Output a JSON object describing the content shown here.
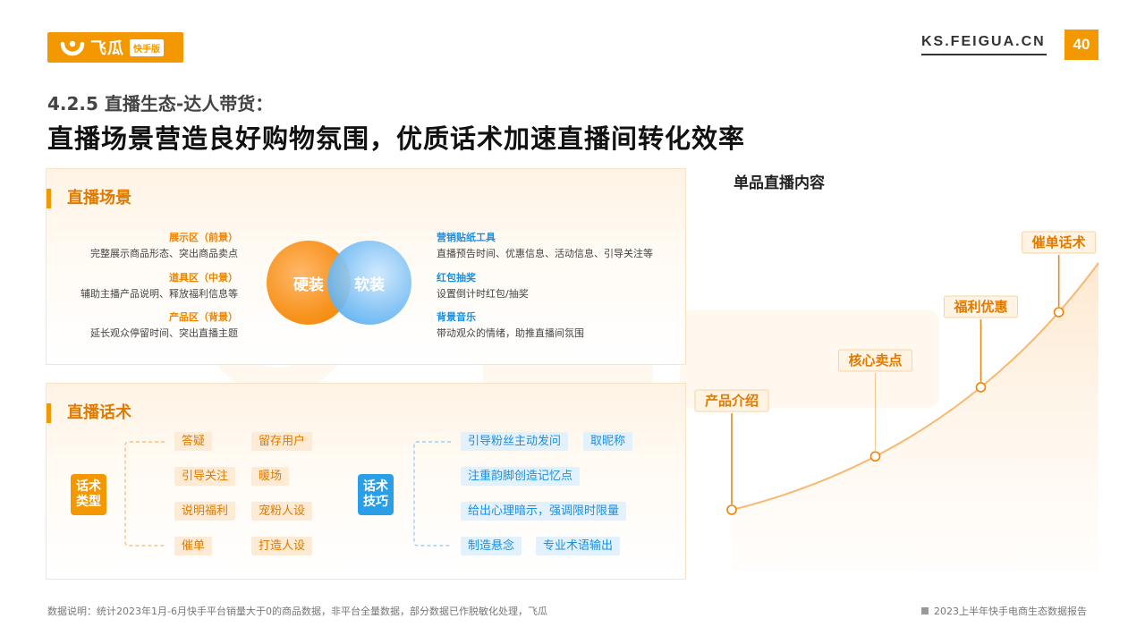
{
  "header": {
    "logo_name": "飞瓜",
    "logo_badge": "快手版",
    "site": "KS.FEIGUA.CN",
    "page_number": "40"
  },
  "section_label": "4.2.5 直播生态-达人带货：",
  "headline": "直播场景营造良好购物氛围，优质话术加速直播间转化效率",
  "scene": {
    "title": "直播场景",
    "zones": [
      {
        "title": "展示区（前景）",
        "desc": "完整展示商品形态、突出商品卖点"
      },
      {
        "title": "道具区（中景）",
        "desc": "辅助主播产品说明、释放福利信息等"
      },
      {
        "title": "产品区（背景）",
        "desc": "延长观众停留时间、突出直播主题"
      }
    ],
    "venn": {
      "left": "硬装",
      "right": "软装"
    },
    "tools": [
      {
        "title": "营销贴纸工具",
        "desc": "直播预告时间、优惠信息、活动信息、引导关注等"
      },
      {
        "title": "红包抽奖",
        "desc": "设置倒计时红包/抽奖"
      },
      {
        "title": "背景音乐",
        "desc": "带动观众的情绪，助推直播间氛围"
      }
    ]
  },
  "speech": {
    "title": "直播话术",
    "types_label": "话术\n类型",
    "types": [
      "答疑",
      "留存用户",
      "引导关注",
      "暖场",
      "说明福利",
      "宠粉人设",
      "催单",
      "打造人设"
    ],
    "skills_label": "话术\n技巧",
    "skills": [
      "引导粉丝主动发问",
      "取昵称",
      "注重韵脚创造记忆点",
      "给出心理暗示，强调限时限量",
      "制造悬念",
      "专业术语输出"
    ]
  },
  "chart_title": "单品直播内容",
  "chart_data": {
    "type": "line",
    "title": "单品直播内容",
    "categories": [
      "产品介绍",
      "核心卖点",
      "福利优惠",
      "催单话术"
    ],
    "x": [
      "产品介绍",
      "核心卖点",
      "福利优惠",
      "催单话术"
    ],
    "values": [
      1,
      2,
      3,
      4
    ],
    "xlabel": "",
    "ylabel": "",
    "grid": false
  },
  "colors": {
    "orange": "#f39800",
    "blue": "#2b9ee8"
  },
  "footnote": "数据说明：统计2023年1月-6月快手平台销量大于0的商品数据，非平台全量数据，部分数据已作脱敏化处理，飞瓜",
  "report": "2023上半年快手电商生态数据报告"
}
